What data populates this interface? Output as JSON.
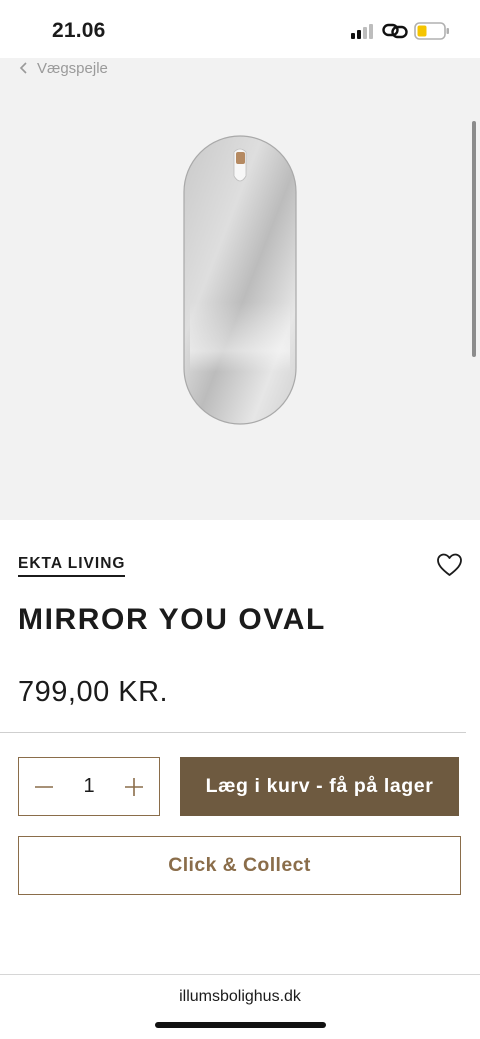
{
  "status_bar": {
    "time": "21.06",
    "icons": [
      "cellular-signal-icon",
      "link-icon",
      "battery-low-icon"
    ],
    "battery_color": "#f5c400"
  },
  "breadcrumb": {
    "back_label": "Vægspejle",
    "icon": "chevron-left-icon"
  },
  "product": {
    "image": "oval-mirror-with-leather-strap",
    "brand": "EKTA LIVING",
    "title": "MIRROR YOU OVAL",
    "price": "799,00 KR.",
    "wishlist_icon": "heart-icon"
  },
  "purchase": {
    "quantity": "1",
    "decrement_icon": "minus-icon",
    "increment_icon": "plus-icon",
    "add_to_cart_label": "Læg i kurv - få på lager",
    "click_collect_label": "Click & Collect"
  },
  "browser": {
    "url": "illumsbolighus.dk"
  },
  "colors": {
    "accent_brown": "#6e5a40",
    "outline_brown": "#8a6d4a",
    "image_background": "#f2f2f2",
    "text": "#1b1b1b"
  }
}
